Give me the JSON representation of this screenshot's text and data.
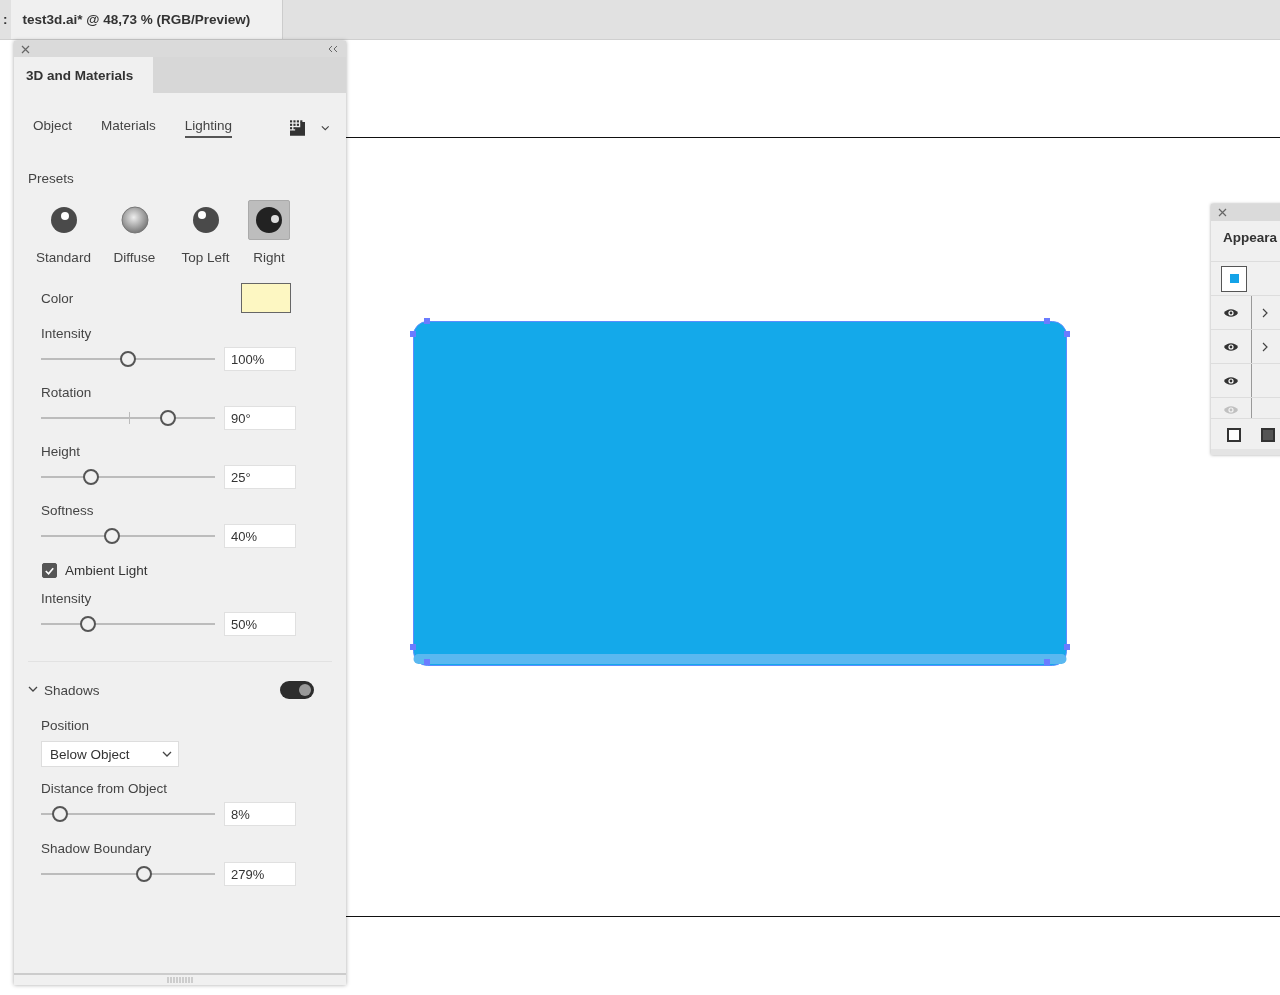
{
  "document_tabs": [
    {
      "title": ":",
      "selected": false
    },
    {
      "title": "test3d.ai* @ 48,73 % (RGB/Preview)",
      "selected": true
    }
  ],
  "panel": {
    "title": "3D and Materials",
    "tabs": [
      {
        "label": "Object",
        "selected": false
      },
      {
        "label": "Materials",
        "selected": false
      },
      {
        "label": "Lighting",
        "selected": true
      }
    ],
    "presets_label": "Presets",
    "presets": [
      {
        "label": "Standard",
        "kind": "standard",
        "selected": false
      },
      {
        "label": "Diffuse",
        "kind": "diffuse",
        "selected": false
      },
      {
        "label": "Top Left",
        "kind": "top-left",
        "selected": false
      },
      {
        "label": "Right",
        "kind": "right",
        "selected": true
      }
    ],
    "controls": [
      {
        "kind": "swatch",
        "label": "Color",
        "color": "#fdf7c2"
      },
      {
        "kind": "slider",
        "label": "Intensity",
        "level": 0.5,
        "value": "100%"
      },
      {
        "kind": "slider",
        "label": "Rotation",
        "level": 0.73,
        "value": "90°",
        "center_tick": true
      },
      {
        "kind": "slider",
        "label": "Height",
        "level": 0.29,
        "value": "25°"
      },
      {
        "kind": "slider",
        "label": "Softness",
        "level": 0.41,
        "value": "40%"
      },
      {
        "kind": "checkbox",
        "label": "Ambient Light",
        "checked": true
      },
      {
        "kind": "slider",
        "label": "Intensity",
        "level": 0.27,
        "value": "50%"
      }
    ],
    "shadows": {
      "label": "Shadows",
      "expanded": true,
      "on": true,
      "position_label": "Position",
      "position_value": "Below Object",
      "sliders": [
        {
          "label": "Distance from Object",
          "level": 0.11,
          "value": "8%"
        },
        {
          "label": "Shadow Boundary",
          "level": 0.59,
          "value": "279%"
        }
      ]
    }
  },
  "appearance_panel": {
    "title": "Appeara",
    "rows": [
      {
        "kind": "swatch",
        "color": "#14a3e8"
      },
      {
        "kind": "eye",
        "expandable": true,
        "dimmed": false
      },
      {
        "kind": "eye",
        "expandable": true,
        "dimmed": false
      },
      {
        "kind": "eye",
        "expandable": false,
        "dimmed": false
      },
      {
        "kind": "eye",
        "expandable": false,
        "dimmed": true
      }
    ]
  }
}
